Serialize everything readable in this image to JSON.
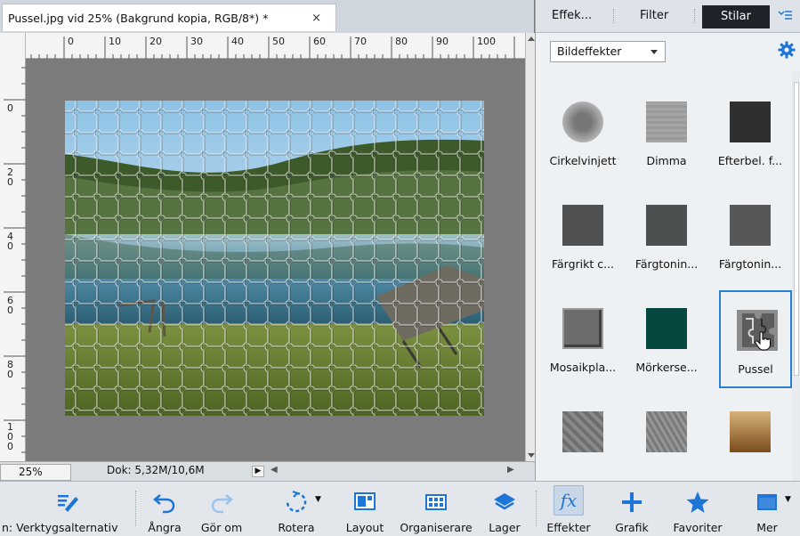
{
  "document": {
    "tab_title": "Pussel.jpg vid 25% (Bakgrund kopia, RGB/8*) *",
    "close_glyph": "×"
  },
  "ruler": {
    "top_labels": [
      "0",
      "10",
      "20",
      "30",
      "40",
      "50",
      "60",
      "70",
      "80",
      "90",
      "100"
    ],
    "left_labels": [
      "0",
      "2 0",
      "4 0",
      "6 0",
      "8 0",
      "1 0 0"
    ]
  },
  "status": {
    "zoom": "25%",
    "doc_size": "Dok: 5,32M/10,6M"
  },
  "panel": {
    "tabs": [
      "Effek...",
      "Filter",
      "Stilar"
    ],
    "active_tab": "Stilar",
    "menu_icon": "panel-menu-icon",
    "dropdown_value": "Bildeffekter",
    "styles": [
      {
        "label": "Cirkelvinjett",
        "color": "#8a8a8a"
      },
      {
        "label": "Dimma",
        "color": "#9e9e9e"
      },
      {
        "label": "Efterbel. f...",
        "color": "#2f2f2f"
      },
      {
        "label": "Färgrikt c...",
        "color": "#4f5152"
      },
      {
        "label": "Färgtonin...",
        "color": "#4d5050"
      },
      {
        "label": "Färgtonin...",
        "color": "#575757"
      },
      {
        "label": "Mosaikpla...",
        "color": "#6c6c6c"
      },
      {
        "label": "Mörkerse...",
        "color": "#064840"
      },
      {
        "label": "Pussel",
        "color": "#8c8c8c"
      },
      {
        "label": "",
        "color": "#6e6e6e"
      },
      {
        "label": "",
        "color": "#7a7a7a"
      },
      {
        "label": "",
        "color": "#7a4c1c"
      }
    ],
    "selected_style": "Pussel"
  },
  "toolbar": {
    "items": [
      {
        "label": "n: Verktygsalternativ",
        "icon": "tool-options-icon"
      },
      {
        "label": "Ångra",
        "icon": "undo-icon"
      },
      {
        "label": "Gör om",
        "icon": "redo-icon"
      },
      {
        "label": "Rotera",
        "icon": "rotate-icon"
      },
      {
        "label": "Layout",
        "icon": "layout-icon"
      },
      {
        "label": "Organiserare",
        "icon": "organizer-icon"
      },
      {
        "label": "Lager",
        "icon": "layers-icon"
      },
      {
        "label": "Effekter",
        "icon": "fx-icon"
      },
      {
        "label": "Grafik",
        "icon": "graphics-plus-icon"
      },
      {
        "label": "Favoriter",
        "icon": "favorites-star-icon"
      },
      {
        "label": "Mer",
        "icon": "more-panel-icon"
      }
    ],
    "fx_glyph": "fx",
    "active": "Effekter"
  },
  "colors": {
    "accent": "#1e75d8",
    "selection": "#2a7fd4",
    "active_tab_bg": "#1f2329"
  }
}
